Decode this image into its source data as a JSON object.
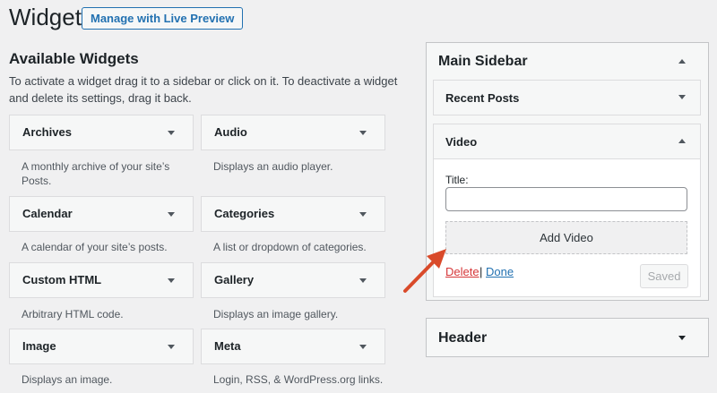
{
  "header": {
    "title": "Widgets",
    "live_preview_label": "Manage with Live Preview"
  },
  "available": {
    "title": "Available Widgets",
    "description": "To activate a widget drag it to a sidebar or click on it. To deactivate a widget and delete its settings, drag it back.",
    "widgets": [
      {
        "name": "Archives",
        "description": "A monthly archive of your site’s Posts."
      },
      {
        "name": "Audio",
        "description": "Displays an audio player."
      },
      {
        "name": "Calendar",
        "description": "A calendar of your site’s posts."
      },
      {
        "name": "Categories",
        "description": "A list or dropdown of categories."
      },
      {
        "name": "Custom HTML",
        "description": "Arbitrary HTML code."
      },
      {
        "name": "Gallery",
        "description": "Displays an image gallery."
      },
      {
        "name": "Image",
        "description": "Displays an image."
      },
      {
        "name": "Meta",
        "description": "Login, RSS, & WordPress.org links."
      }
    ]
  },
  "main_sidebar": {
    "title": "Main Sidebar",
    "widgets": {
      "recent_posts": "Recent Posts",
      "video": {
        "label": "Video",
        "title_label": "Title:",
        "title_value": "",
        "add_video_label": "Add Video",
        "delete_label": "Delete",
        "separator": "|",
        "done_label": "Done",
        "saved_label": "Saved"
      }
    }
  },
  "header_sidebar": {
    "title": "Header"
  },
  "colors": {
    "accent": "#2271b1",
    "delete": "#d63638",
    "arrow": "#d94a2a",
    "background": "#f0f0f1"
  }
}
